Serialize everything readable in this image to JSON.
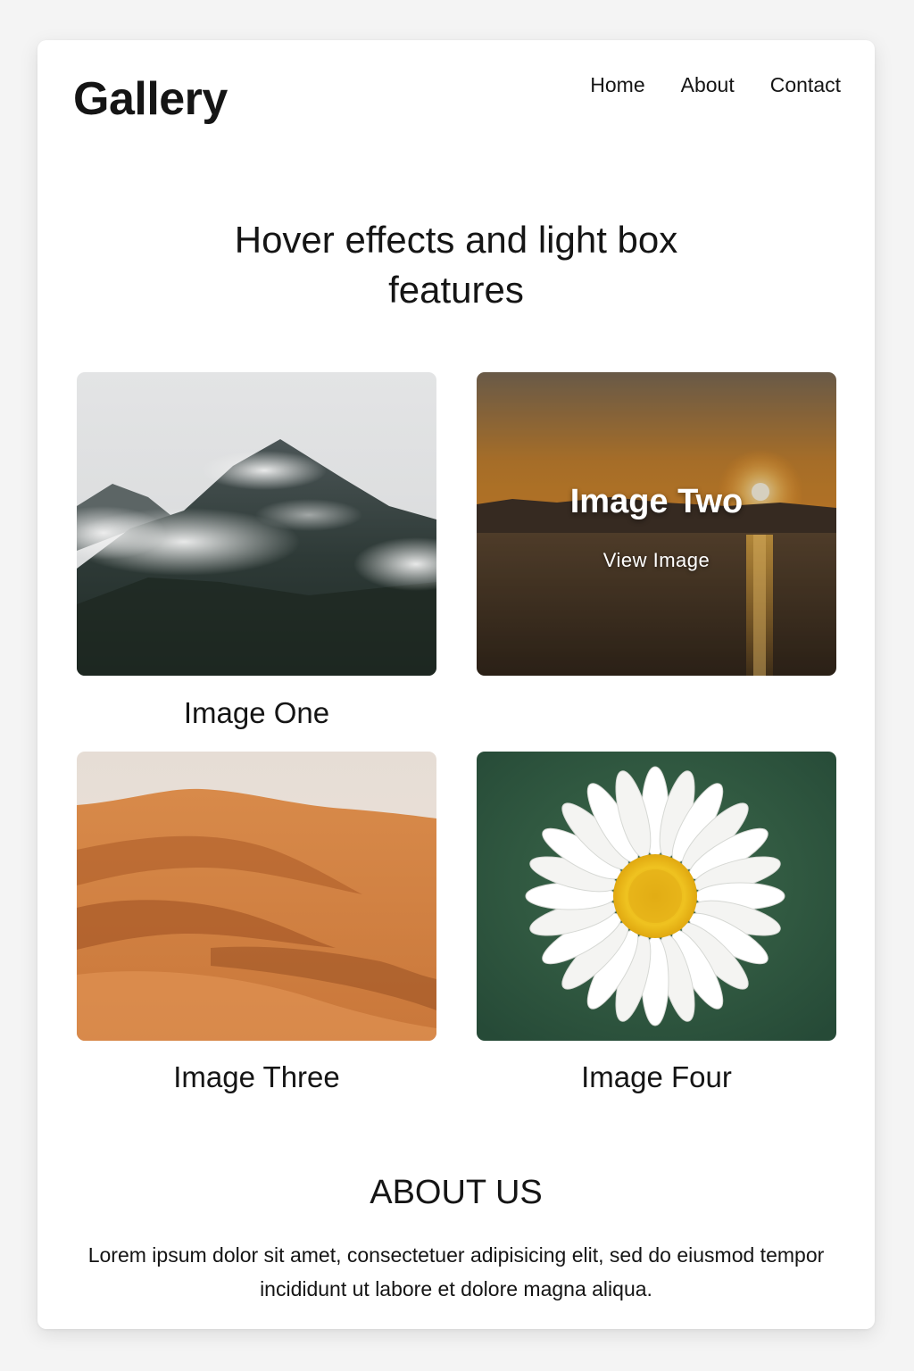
{
  "header": {
    "logo": "Gallery",
    "nav": [
      {
        "label": "Home"
      },
      {
        "label": "About"
      },
      {
        "label": "Contact"
      }
    ]
  },
  "hero": {
    "title": "Hover effects and light box features"
  },
  "gallery": {
    "items": [
      {
        "caption": "Image One",
        "subject": "misty-mountain"
      },
      {
        "caption": "",
        "subject": "sunset-over-water",
        "overlay_title": "Image Two",
        "overlay_link": "View Image"
      },
      {
        "caption": "Image Three",
        "subject": "sand-dunes"
      },
      {
        "caption": "Image Four",
        "subject": "daisy-flower"
      }
    ]
  },
  "about": {
    "title": "ABOUT US",
    "text": "Lorem ipsum dolor sit amet, consectetuer adipisicing elit, sed do eiusmod tempor incididunt ut labore et dolore magna aliqua."
  }
}
